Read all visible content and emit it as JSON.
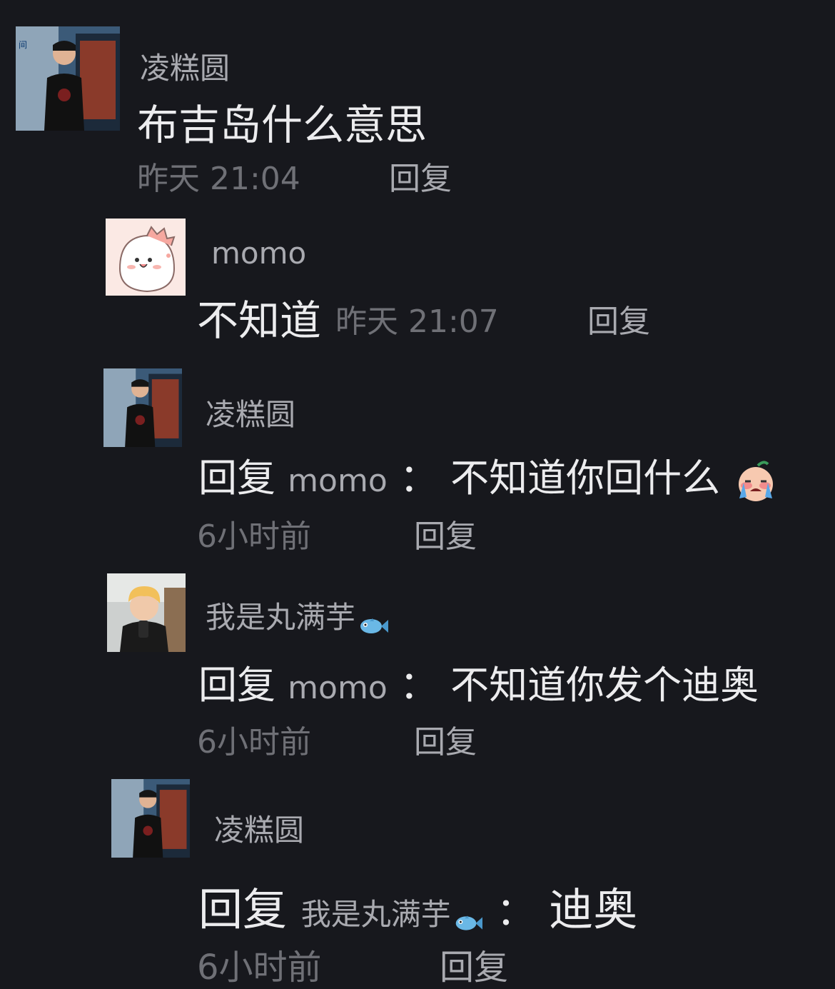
{
  "comments": [
    {
      "username": "凌糕圆",
      "text": "布吉岛什么意思",
      "time": "昨天 21:04",
      "reply_label": "回复"
    },
    {
      "username": "momo",
      "text": "不知道",
      "time": "昨天 21:07",
      "reply_label": "回复"
    },
    {
      "username": "凌糕圆",
      "reply_prefix": "回复",
      "reply_target": "momo",
      "separator": "：",
      "text": "不知道你回什么",
      "time": "6小时前",
      "reply_label": "回复",
      "emoji": "crying-face-emoji"
    },
    {
      "username": "我是丸满芋",
      "username_emoji": "fish-emoji",
      "reply_prefix": "回复",
      "reply_target": "momo",
      "separator": "：",
      "text": "不知道你发个迪奥",
      "time": "6小时前",
      "reply_label": "回复"
    },
    {
      "username": "凌糕圆",
      "reply_prefix": "回复",
      "reply_target": "我是丸满芋",
      "reply_target_emoji": "fish-emoji",
      "separator": "：",
      "text": "迪奥",
      "time": "6小时前",
      "reply_label": "回复"
    }
  ],
  "colors": {
    "background": "#17181d",
    "username": "#a9aab0",
    "content": "#ececee",
    "time": "#6f7076"
  }
}
